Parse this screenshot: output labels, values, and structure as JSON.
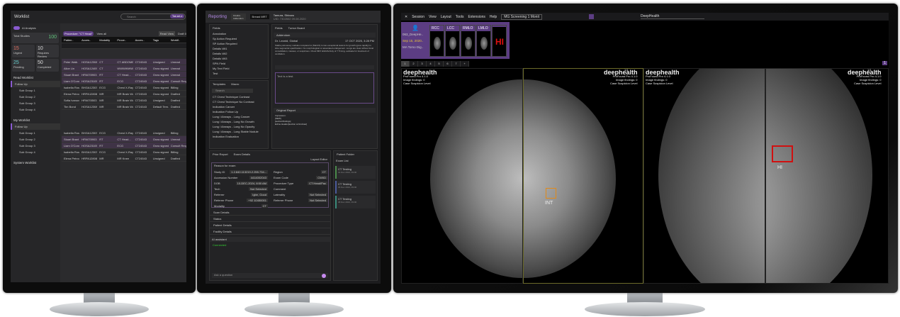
{
  "worklist": {
    "title": "Worklist",
    "search_placeholder": "Search",
    "user_button": "Tae-sei-e",
    "ai_toggle": "AI Analysis",
    "total_label": "Total Studies",
    "total": "100",
    "stats": [
      {
        "label": "Urgent",
        "value": "15"
      },
      {
        "label": "Requires Review",
        "value": "10"
      },
      {
        "label": "Pending",
        "value": "25"
      },
      {
        "label": "Completed",
        "value": "50"
      }
    ],
    "filter_chip": "Procedure: \"CT Head\"",
    "view_all": "View all",
    "read_view": "Read View",
    "draft": "Draft 0",
    "columns": [
      "Patien..",
      "Acces..",
      "Modality",
      "Proce..",
      "Acces..",
      "Tags",
      "Workfl.."
    ],
    "rows": [
      [
        "Peter Walk",
        "HOSA12308",
        "CT",
        "CT ABDOME...",
        "CT24543",
        "Unsigned",
        "Unread"
      ],
      [
        "Alice Lin",
        "HOSA12409",
        "CT",
        "WWWWWWA...",
        "CT24543",
        "Grow signed...",
        "Unread"
      ],
      [
        "Stuart Braxt",
        "HPA078903",
        "RT",
        "CT Head...",
        "CT24543",
        "Grow signed...",
        "Unread"
      ],
      [
        "Liam O'Connor",
        "HOSA23105",
        "RT",
        "ECG",
        "CT24543",
        "Grow signed...",
        "Consult Req"
      ],
      [
        "Isabella Rossi",
        "BHGA12303",
        "ECG",
        "Chest X-Ray",
        "CT24543",
        "Grow signed...",
        "Billing"
      ],
      [
        "Elena Petrova",
        "HRPA12808",
        "MR",
        "MR Brain Wo",
        "CT24543",
        "Grow signed...",
        "Drafted"
      ],
      [
        "Sofia Ivanova",
        "HPA078503",
        "MR",
        "MR Brain Wo",
        "CT24543",
        "Unsigned",
        "Drafted"
      ],
      [
        "Tim Bond",
        "HOSA12308",
        "MR",
        "MR Brain Wo",
        "CT24543",
        "Default Tem...",
        "Drafted"
      ]
    ],
    "rows2": [
      [
        "Isabella Rossi",
        "BHGA12303",
        "ECG",
        "Chest X-Ray",
        "CT24543",
        "Unsigned",
        "Billing"
      ],
      [
        "Stuart Braxt",
        "HPA078903",
        "RT",
        "CT Head...",
        "CT24543",
        "Grow signed...",
        "Unread"
      ],
      [
        "Liam O'Connor",
        "HOSA23105",
        "RT",
        "ECG",
        "CT24543",
        "Grow signed...",
        "Consult Req"
      ],
      [
        "Isabella Rossi",
        "BHGA12303",
        "ECG",
        "Chest X-Ray",
        "CT24543",
        "Grow signed...",
        "Billing"
      ],
      [
        "Elena Petrova",
        "HRPA12808",
        "MR",
        "MR Knee",
        "CT24543",
        "Unsigned",
        "Drafted"
      ]
    ],
    "read_worklist": "Read Worklist",
    "my_worklist": "My Worklist",
    "system_worklist": "System Worklist",
    "groups": [
      {
        "label": "Follow Up",
        "count": "40"
      },
      {
        "label": "Sub Group 1",
        "count": "10"
      },
      {
        "label": "Sub Group 2",
        "count": "8"
      },
      {
        "label": "Sub Group 3",
        "count": "12"
      },
      {
        "label": "Sub Group 4",
        "count": "10"
      }
    ]
  },
  "reporting": {
    "title": "Reporting",
    "finalize": "Finalize\nAddendum",
    "btn2": "Breast MRT",
    "patient": "Tamura, Shinaru",
    "patient_sub": "UID: 7302502 09.08.2020",
    "fields_tab": "Fields",
    "fields": [
      "Annotation",
      "Sp Action Required",
      "SP Action Required",
      "Details Wt1",
      "Details Wt2",
      "Details Wt3",
      "SPN Field",
      "My Text Field",
      "Test"
    ],
    "templates_tab": "Templates",
    "macro_tab": "Macro",
    "template_search": "Search",
    "templates": [
      "CT Chest Technique Contrast",
      "CT Chest Technique No Contrast",
      "Indication Cancer",
      "Indication Follow Up",
      "Lung / Airways - Lung Cancer",
      "Lung / Airways - Lung No Growth",
      "Lung / Airways - Lung No Opacity",
      "Lung / Airways - Lung Stable Nodule",
      "Indication Evaluation"
    ],
    "report_tab": "Fields",
    "tumor_tab": "Tumor Board",
    "addendum": "Addendum",
    "author": "Dr. Leonid, Global",
    "date": "17 OCT 2025, 3:28 PM",
    "addendum_text": "Stable pulmonary nodules compared to (Mar/21) to two exceptional lesions for growth (grew rapidly) in lobe segmental opacification. No morphological or associated enlargement. Lungs are clear without focal consolidation, masses, or suspicious. Chest MRI: EGD/Activity of 7 Timing, evaluate for treatment of ventilation.",
    "editor_placeholder": "Text is a test.",
    "orig_report": "Original Report",
    "orig_lines": [
      "Impression:",
      "[NEW]",
      "[section/findings]",
      "Exline Header[section scrimshaw]"
    ],
    "prior_tab": "Prior Report",
    "exam_tab": "Exam Details",
    "layout_editor": "Layout Editor",
    "reason": "Reason for exam",
    "exam_fields": [
      [
        "Study ID",
        "1.2.840.113219.2.255.734..."
      ],
      [
        "Accession Number",
        "4414002043"
      ],
      [
        "DOB",
        "10-DEC-2024, 8:50 AM"
      ],
      [
        "Tech",
        "Not Selected"
      ],
      [
        "Referrer",
        "Igbe, Good"
      ],
      [
        "Referrer Phone",
        "+92 10450001"
      ],
      [
        "Modality",
        "CT"
      ]
    ],
    "exam_fields_r": [
      [
        "Region",
        "CT"
      ],
      [
        "Exam Code",
        "CW0D"
      ],
      [
        "Procedure Type",
        "CT Head/Pac"
      ],
      [
        "Comment",
        ""
      ],
      [
        "Laterality",
        "Not Selected"
      ],
      [
        "Referrer Phone",
        "Not Selected"
      ]
    ],
    "sections": [
      "Scan Details",
      "Status",
      "Patient Details",
      "Facility Details"
    ],
    "ai_tab": "AI assistant",
    "ai_status": "Connected",
    "ai_placeholder": "Ask a question",
    "folder_tab": "Patient Folder",
    "exam_list": "Exam List",
    "exams": [
      {
        "name": "CT Testing",
        "date": "01 Dec 2024, 09:00"
      },
      {
        "name": "CT Testing",
        "date": "05 Dec 2024, 09:00"
      },
      {
        "name": "CT Testing",
        "date": "08 Dec 2024, 09:00"
      }
    ]
  },
  "viewer": {
    "menu": [
      "Session",
      "View",
      "Layout",
      "Tools",
      "Extensions",
      "Help"
    ],
    "protocol": "MG Screening 1 Monit",
    "ai_dropdown": "DeepHealth",
    "patient": "063_DeepHe..",
    "date": "Sep 15, 2020..",
    "study": "MA Tomo Dig..",
    "thumbs": [
      "RCC",
      "LCC",
      "RMLO",
      "LMLO",
      ""
    ],
    "thumb_hi": "HI",
    "pages": [
      "1",
      "2",
      "3",
      "4",
      "5",
      "6",
      "7",
      "+"
    ],
    "page_right": "1",
    "logo": "deephealth",
    "product": "ProFound Pro 4.1.0",
    "findings": "Image findings: 0",
    "suspicion": "Case Suspicion Level",
    "counter": "1/1",
    "mark_int": "INT",
    "mark_hi": "HI",
    "colors": {
      "accent": "#5c3d83",
      "int": "#e08a1a",
      "hi": "#d01010"
    }
  }
}
